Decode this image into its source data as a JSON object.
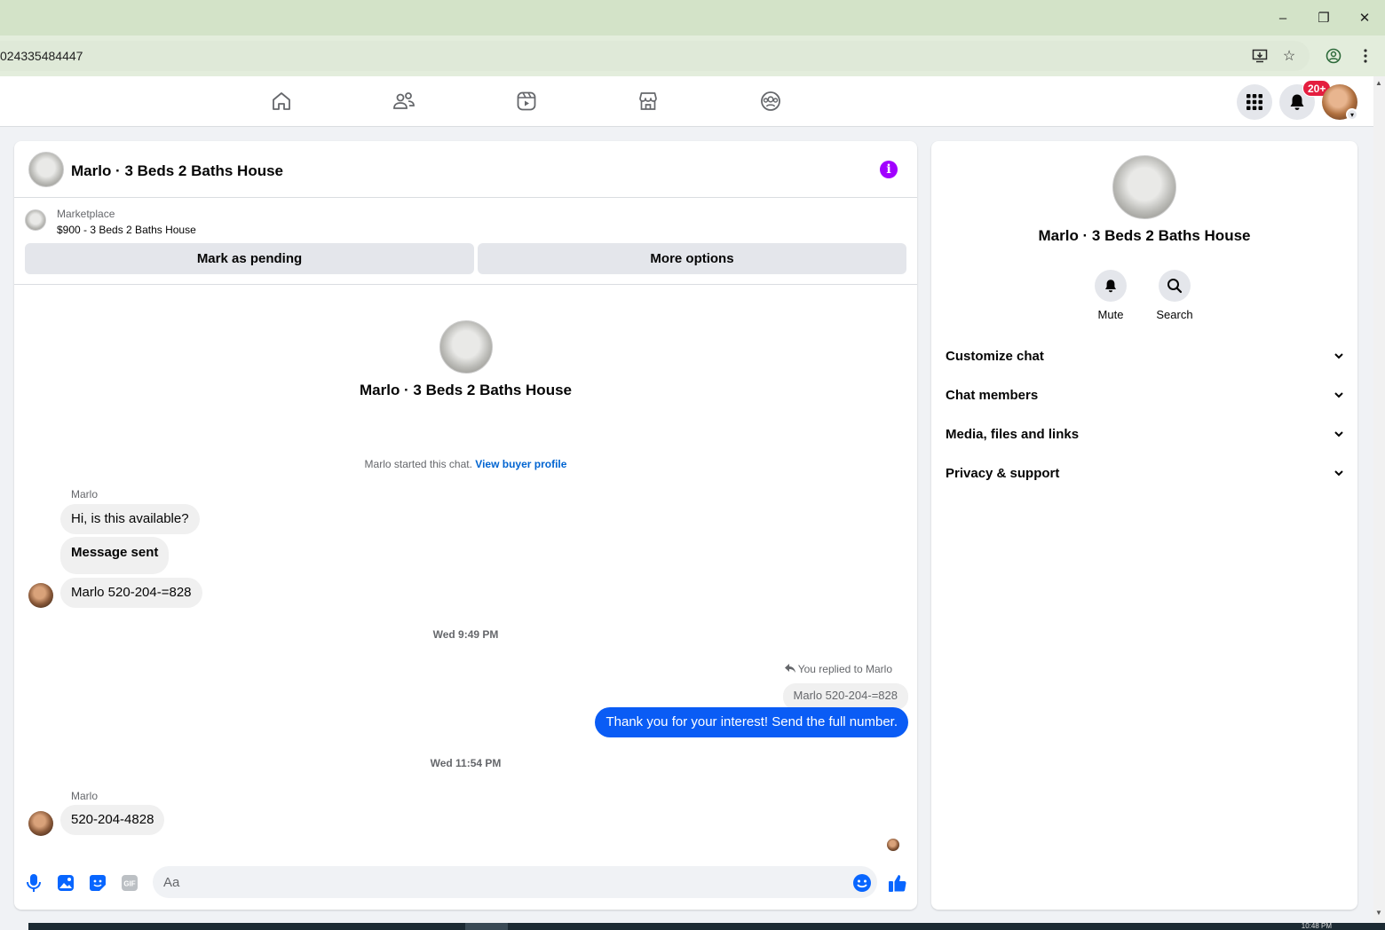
{
  "browser": {
    "url_fragment": "024335484447",
    "controls": {
      "minimize": "–",
      "restore": "❐",
      "close": "✕"
    }
  },
  "fb_nav": {
    "tabs": [
      "home-icon",
      "friends-icon",
      "video-icon",
      "marketplace-icon",
      "groups-icon"
    ],
    "notification_badge": "20+"
  },
  "chat": {
    "title": "Marlo · 3 Beds 2 Baths House",
    "listing": {
      "source": "Marketplace",
      "item": "$900 - 3 Beds 2 Baths House"
    },
    "buttons": {
      "mark_pending": "Mark as pending",
      "more_options": "More options"
    },
    "intro_title": "Marlo · 3 Beds 2 Baths House",
    "started_text": "Marlo started this chat.",
    "view_buyer_profile": "View buyer profile",
    "group1": {
      "sender": "Marlo",
      "messages": [
        "Hi, is this available?",
        "Message sent",
        "Marlo 520-204-=828"
      ]
    },
    "timestamp1": "Wed 9:49 PM",
    "reply": {
      "label": "You replied to Marlo",
      "quoted": "Marlo 520-204-=828",
      "text": "Thank you for your interest! Send the full number."
    },
    "timestamp2": "Wed 11:54 PM",
    "group2": {
      "sender": "Marlo",
      "messages": [
        "520-204-4828"
      ]
    },
    "composer": {
      "placeholder": "Aa"
    }
  },
  "info_panel": {
    "title": "Marlo · 3 Beds 2 Baths House",
    "actions": {
      "mute": "Mute",
      "search": "Search"
    },
    "sections": [
      "Customize chat",
      "Chat members",
      "Media, files and links",
      "Privacy & support"
    ]
  },
  "taskbar": {
    "clock": "10:48 PM"
  },
  "colors": {
    "accent": "#0a5cf5",
    "info_purple": "#a100ff",
    "messenger_blue": "#0866ff"
  }
}
